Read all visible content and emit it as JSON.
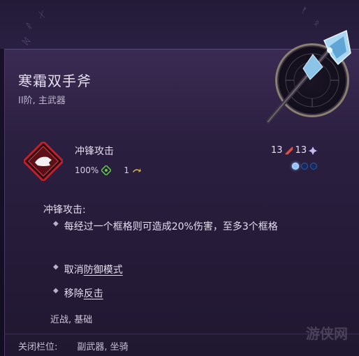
{
  "item": {
    "name": "寒霜双手斧",
    "subtitle": "II阶, 主武器",
    "icon": "frost-axe-icon"
  },
  "skill": {
    "name": "冲锋攻击",
    "accuracy": "100%",
    "move_range": "1",
    "damage_min": "13",
    "damage_max": "13",
    "ap_dots": [
      true,
      false,
      false
    ],
    "colors": {
      "accent_red": "#c0202a",
      "dot_on": "#8fc3ff",
      "accuracy_icon": "#5fd04a",
      "move_icon": "#e6b84a"
    }
  },
  "description": {
    "heading": "冲锋攻击:",
    "bullet1": "每经过一个框格则可造成20%伤害，至多3个框格",
    "bullet2_prefix": "取消",
    "bullet2_link": "防御模式",
    "bullet3_prefix": "移除",
    "bullet3_link": "反击",
    "tags": "近战, 基础"
  },
  "footer": {
    "label": "关闭栏位:",
    "value": "副武器, 坐骑"
  },
  "watermark": "游侠网"
}
